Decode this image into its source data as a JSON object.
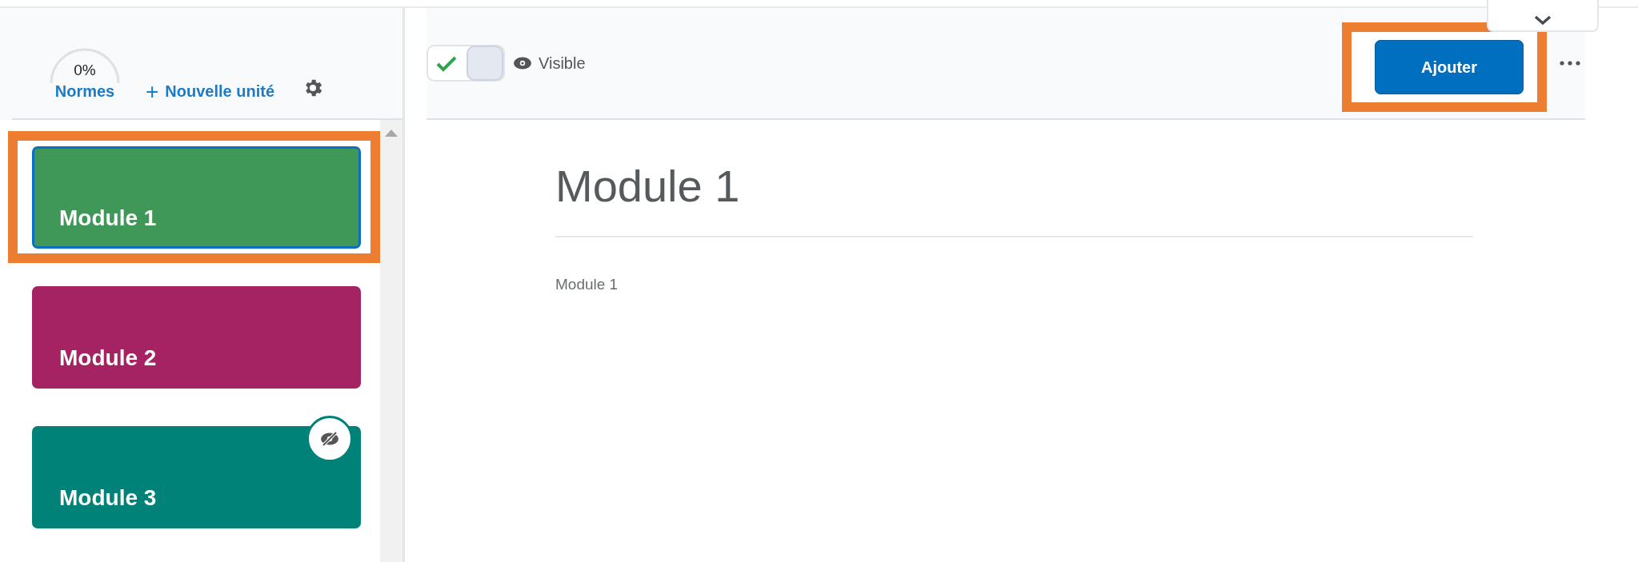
{
  "progress": {
    "reading": "0%",
    "label": "Normes"
  },
  "new_unit": {
    "icon": "+",
    "label": "Nouvelle unité"
  },
  "modules": [
    {
      "title": "Module 1",
      "color": "#409858",
      "selected": true,
      "hidden": false,
      "highlighted": true
    },
    {
      "title": "Module 2",
      "color": "#a52362",
      "selected": false,
      "hidden": false,
      "highlighted": false
    },
    {
      "title": "Module 3",
      "color": "#008279",
      "selected": false,
      "hidden": true,
      "highlighted": false
    }
  ],
  "toolbar": {
    "visibility": {
      "on": true,
      "label": "Visible"
    },
    "add_button": {
      "label": "Ajouter",
      "highlighted": true
    }
  },
  "content": {
    "title": "Module 1",
    "description": "Module 1"
  }
}
